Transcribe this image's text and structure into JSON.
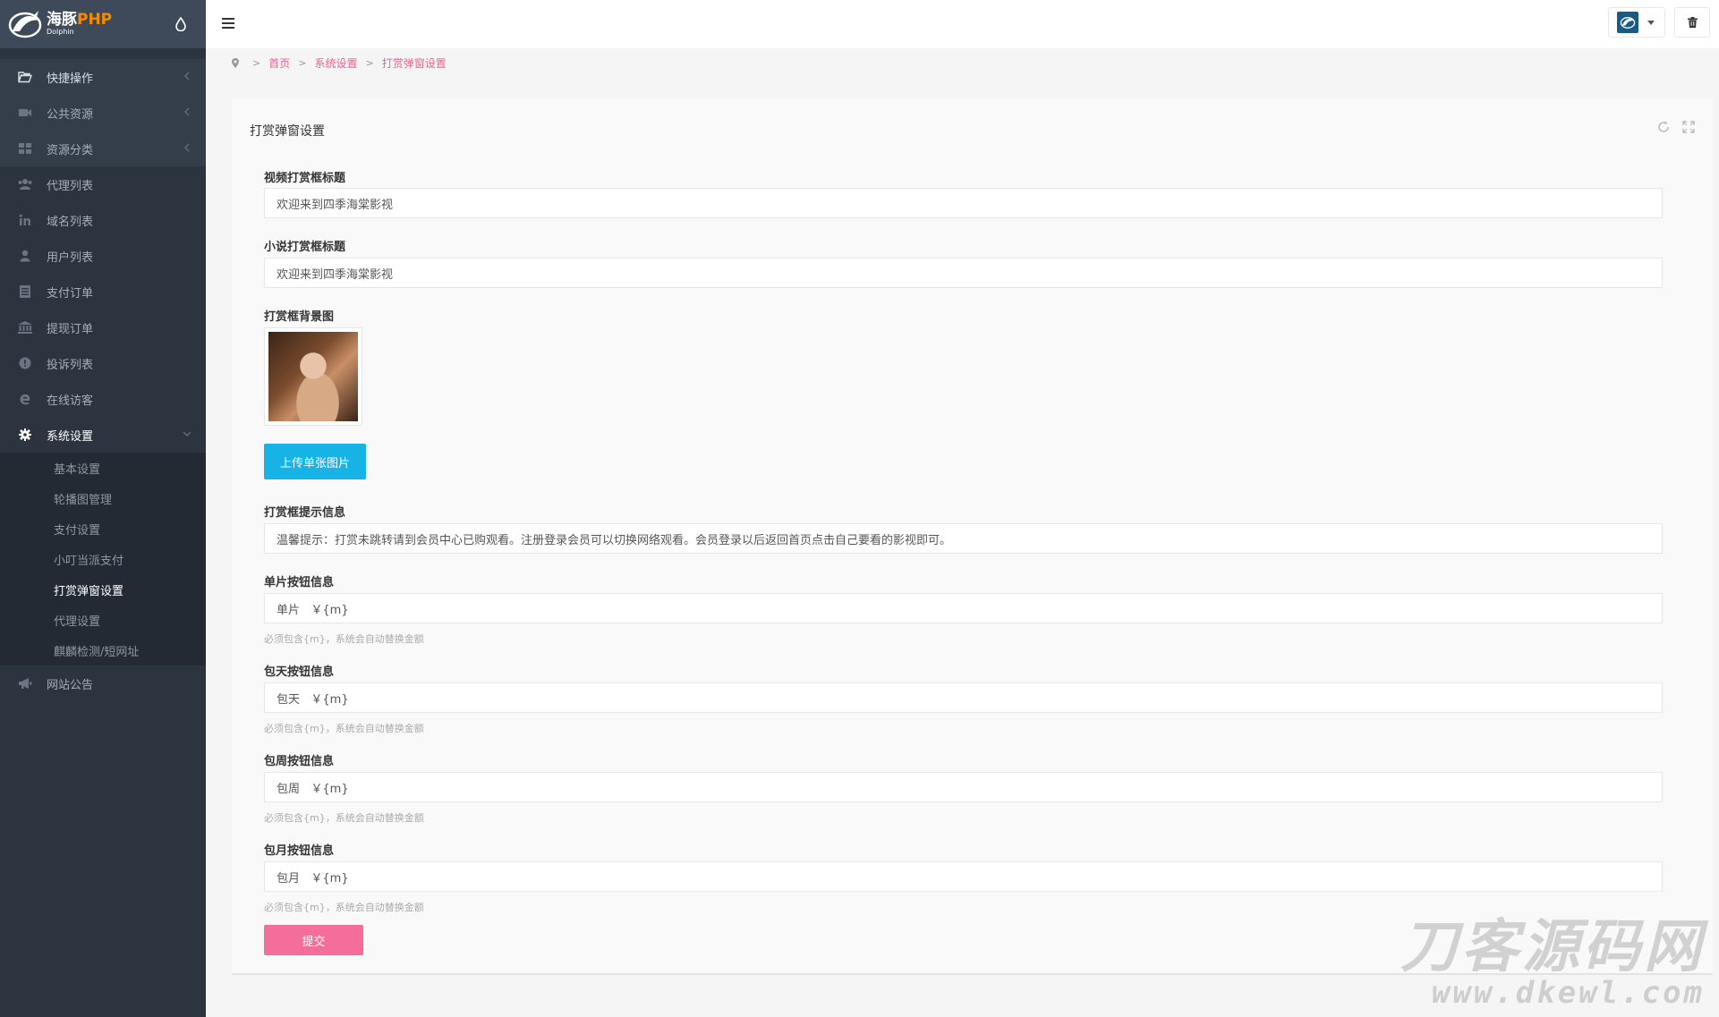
{
  "brand": {
    "name_cn": "海豚",
    "name_php": "PHP",
    "sub": "Dolphin"
  },
  "sidebar": {
    "items": [
      {
        "label": "快捷操作",
        "icon": "folder-open-icon"
      },
      {
        "label": "公共资源",
        "icon": "video-camera-icon"
      },
      {
        "label": "资源分类",
        "icon": "grid-icon"
      },
      {
        "label": "代理列表",
        "icon": "users-icon"
      },
      {
        "label": "域名列表",
        "icon": "linkedin-icon"
      },
      {
        "label": "用户列表",
        "icon": "user-icon"
      },
      {
        "label": "支付订单",
        "icon": "list-icon"
      },
      {
        "label": "提现订单",
        "icon": "bank-icon"
      },
      {
        "label": "投诉列表",
        "icon": "info-circle-icon"
      },
      {
        "label": "在线访客",
        "icon": "ie-icon"
      },
      {
        "label": "系统设置",
        "icon": "gear-icon"
      }
    ],
    "sub_items": [
      {
        "label": "基本设置"
      },
      {
        "label": "轮播图管理"
      },
      {
        "label": "支付设置"
      },
      {
        "label": "小叮当派支付"
      },
      {
        "label": "打赏弹窗设置"
      },
      {
        "label": "代理设置"
      },
      {
        "label": "麒麟检测/短网址"
      }
    ],
    "last_item": {
      "label": "网站公告",
      "icon": "bullhorn-icon"
    }
  },
  "breadcrumb": [
    "首页",
    "系统设置",
    "打赏弹窗设置"
  ],
  "panel": {
    "title": "打赏弹窗设置"
  },
  "form": {
    "video_title": {
      "label": "视频打赏框标题",
      "value": "欢迎来到四季海棠影视"
    },
    "novel_title": {
      "label": "小说打赏框标题",
      "value": "欢迎来到四季海棠影视"
    },
    "bg_image": {
      "label": "打赏框背景图",
      "upload_label": "上传单张图片"
    },
    "tip_info": {
      "label": "打赏框提示信息",
      "value": "温馨提示：打赏未跳转请到会员中心已购观看。注册登录会员可以切换网络观看。会员登录以后返回首页点击自己要看的影视即可。"
    },
    "single_btn": {
      "label": "单片按钮信息",
      "value": "单片   ￥{m}",
      "help": "必须包含{m}，系统会自动替换金额"
    },
    "day_btn": {
      "label": "包天按钮信息",
      "value": "包天   ￥{m}",
      "help": "必须包含{m}，系统会自动替换金额"
    },
    "week_btn": {
      "label": "包周按钮信息",
      "value": "包周   ￥{m}",
      "help": "必须包含{m}，系统会自动替换金额"
    },
    "month_btn": {
      "label": "包月按钮信息",
      "value": "包月   ￥{m}",
      "help": "必须包含{m}，系统会自动替换金额"
    },
    "submit_label": "提交"
  },
  "watermark": {
    "big": "刀客源码网",
    "url": "www.dkewl.com"
  },
  "colors": {
    "sidebar_bg": "#2c343f",
    "accent_pink": "#f55d8f",
    "upload_blue": "#17b2e6",
    "submit_pink": "#f56d9a"
  }
}
